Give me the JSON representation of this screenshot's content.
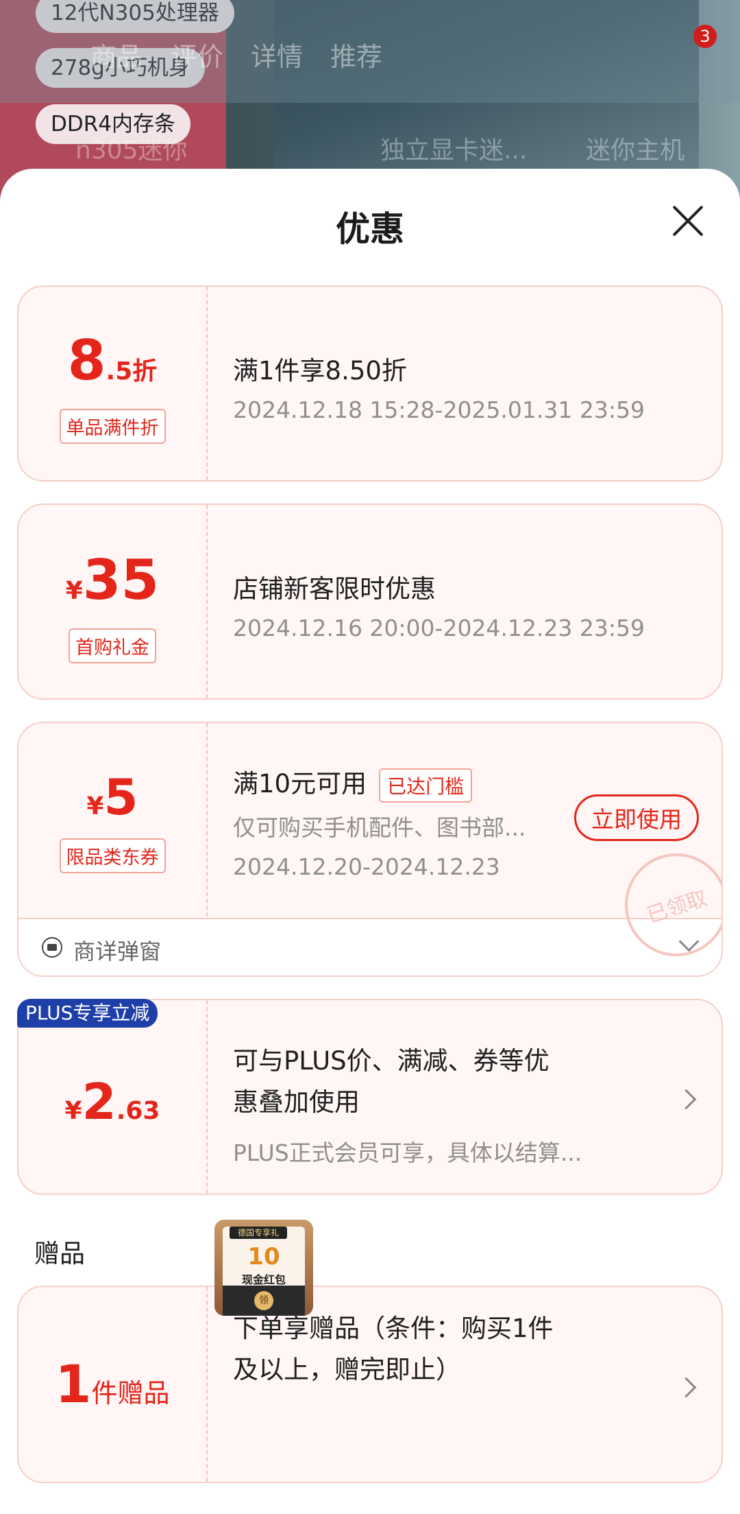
{
  "background": {
    "tags": [
      "12代N305处理器",
      "278g小巧机身",
      "DDR4内存条"
    ],
    "nav_tabs": [
      "商品",
      "评价",
      "详情",
      "推荐"
    ],
    "cart_badge": "3",
    "search_text": "n305迷你",
    "search_suggestions": [
      "独立显卡迷...",
      "迷你主机"
    ]
  },
  "sheet": {
    "title": "优惠"
  },
  "offers": [
    {
      "big": "8",
      "small": ".5折",
      "label": "单品满件折",
      "title": "满1件享8.50折",
      "period": "2024.12.18 15:28-2025.01.31 23:59"
    },
    {
      "yen": "¥",
      "big": "35",
      "label": "首购礼金",
      "title": "店铺新客限时优惠",
      "period": "2024.12.16 20:00-2024.12.23 23:59"
    },
    {
      "yen": "¥",
      "big": "5",
      "label": "限品类东券",
      "title": "满10元可用",
      "tag": "已达门槛",
      "desc": "仅可购买手机配件、图书部...",
      "period": "2024.12.20-2024.12.23",
      "button": "立即使用",
      "stamp": "已领取",
      "footer": "商详弹窗"
    },
    {
      "badge": "PLUS专享立减",
      "yen": "¥",
      "big": "2",
      "small": ".63",
      "title_line1": "可与PLUS价、满减、券等优",
      "title_line2": "惠叠加使用",
      "desc": "PLUS正式会员可享，具体以结算..."
    }
  ],
  "gift_section": {
    "title": "赠品",
    "big": "1",
    "unit": "件赠品",
    "title_line1": "下单享赠品（条件：购买1件",
    "title_line2": "及以上，赠完即止）",
    "image": {
      "header": "德国专享礼",
      "amount": "10",
      "text": "现金红包",
      "seal": "领"
    }
  },
  "colors": {
    "accent": "#e4251a",
    "plus_badge": "#1f3fa8",
    "card_bg": "#fff6f5"
  }
}
